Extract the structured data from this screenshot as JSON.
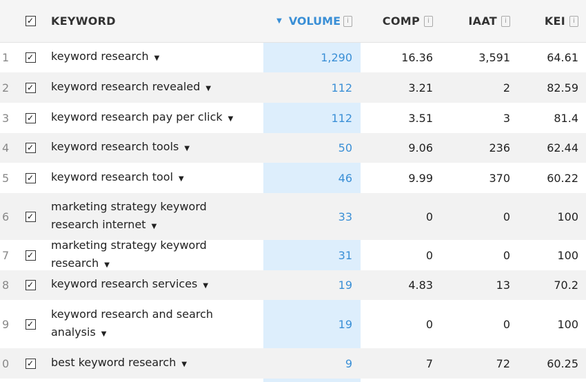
{
  "header": {
    "keyword": "KEYWORD",
    "volume": "VOLUME",
    "comp": "COMP",
    "iaat": "IAAT",
    "kei": "KEI",
    "info_glyph": "i",
    "sort_glyph": "▼",
    "check_glyph": "✓"
  },
  "rows": [
    {
      "num": "1",
      "keyword": "keyword research",
      "volume": "1,290",
      "comp": "16.36",
      "iaat": "3,591",
      "kei": "64.61"
    },
    {
      "num": "2",
      "keyword": "keyword research revealed",
      "volume": "112",
      "comp": "3.21",
      "iaat": "2",
      "kei": "82.59"
    },
    {
      "num": "3",
      "keyword": "keyword research pay per click",
      "volume": "112",
      "comp": "3.51",
      "iaat": "3",
      "kei": "81.4"
    },
    {
      "num": "4",
      "keyword": "keyword research tools",
      "volume": "50",
      "comp": "9.06",
      "iaat": "236",
      "kei": "62.44"
    },
    {
      "num": "5",
      "keyword": "keyword research tool",
      "volume": "46",
      "comp": "9.99",
      "iaat": "370",
      "kei": "60.22"
    },
    {
      "num": "6",
      "keyword": "marketing strategy keyword research internet",
      "volume": "33",
      "comp": "0",
      "iaat": "0",
      "kei": "100"
    },
    {
      "num": "7",
      "keyword": "marketing strategy keyword research",
      "volume": "31",
      "comp": "0",
      "iaat": "0",
      "kei": "100"
    },
    {
      "num": "8",
      "keyword": "keyword research services",
      "volume": "19",
      "comp": "4.83",
      "iaat": "13",
      "kei": "70.2"
    },
    {
      "num": "9",
      "keyword": "keyword research and search analysis",
      "volume": "19",
      "comp": "0",
      "iaat": "0",
      "kei": "100"
    },
    {
      "num": "0",
      "keyword": "best keyword research",
      "volume": "9",
      "comp": "7",
      "iaat": "72",
      "kei": "60.25"
    }
  ],
  "caret_glyph": "▼"
}
